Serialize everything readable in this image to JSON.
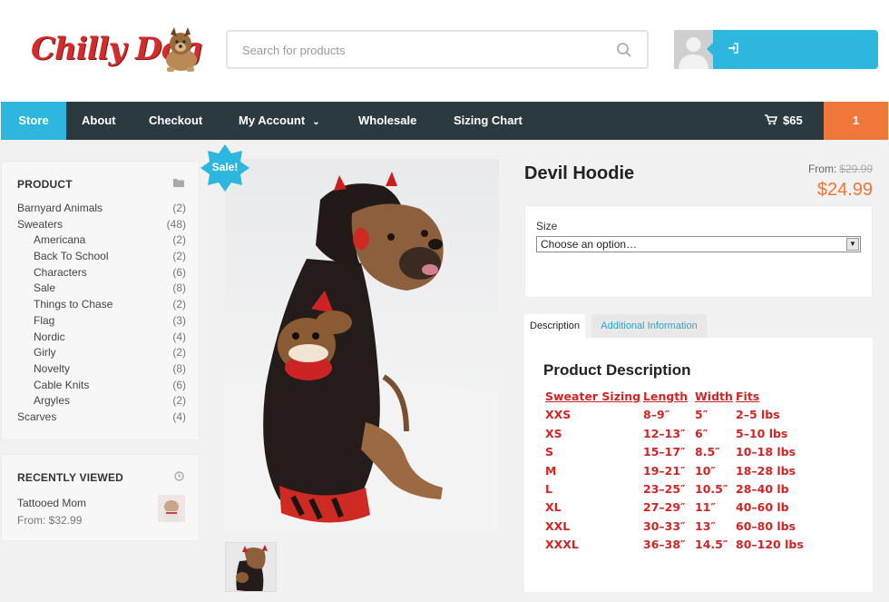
{
  "brand": {
    "name": "Chilly Dog"
  },
  "search": {
    "placeholder": "Search for products"
  },
  "nav": {
    "items": [
      "Store",
      "About",
      "Checkout",
      "My Account",
      "Wholesale",
      "Sizing Chart"
    ],
    "cart_total": "$65",
    "cart_count": "1"
  },
  "sidebar": {
    "product_title": "PRODUCT",
    "categories": [
      {
        "name": "Barnyard Animals",
        "count": "(2)",
        "sub": false
      },
      {
        "name": "Sweaters",
        "count": "(48)",
        "sub": false
      },
      {
        "name": "Americana",
        "count": "(2)",
        "sub": true
      },
      {
        "name": "Back To School",
        "count": "(2)",
        "sub": true
      },
      {
        "name": "Characters",
        "count": "(6)",
        "sub": true
      },
      {
        "name": "Sale",
        "count": "(8)",
        "sub": true
      },
      {
        "name": "Things to Chase",
        "count": "(2)",
        "sub": true
      },
      {
        "name": "Flag",
        "count": "(3)",
        "sub": true
      },
      {
        "name": "Nordic",
        "count": "(4)",
        "sub": true
      },
      {
        "name": "Girly",
        "count": "(2)",
        "sub": true
      },
      {
        "name": "Novelty",
        "count": "(8)",
        "sub": true
      },
      {
        "name": "Cable Knits",
        "count": "(6)",
        "sub": true
      },
      {
        "name": "Argyles",
        "count": "(2)",
        "sub": true
      },
      {
        "name": "Scarves",
        "count": "(4)",
        "sub": false
      }
    ],
    "recent_title": "RECENTLY VIEWED",
    "recent_item": {
      "name": "Tattooed Mom",
      "price": "From: $32.99"
    }
  },
  "product": {
    "badge": "Sale!",
    "title": "Devil Hoodie",
    "from_label": "From:",
    "old_price": "$29.99",
    "price": "$24.99",
    "size_label": "Size",
    "size_selected": "Choose an option…",
    "tabs": [
      "Description",
      "Additional Information"
    ],
    "desc_title": "Product Description",
    "size_table": {
      "header": [
        "Sweater Sizing",
        "Length",
        "Width",
        "Fits"
      ],
      "rows": [
        [
          "XXS",
          "8–9″",
          "5″",
          "2–5 lbs"
        ],
        [
          "XS",
          "12–13″",
          "6″",
          "5–10 lbs"
        ],
        [
          "S",
          "15–17″",
          "8.5″",
          "10–18 lbs"
        ],
        [
          "M",
          "19–21″",
          "10″",
          "18–28 lbs"
        ],
        [
          "L",
          "23–25″",
          "10.5″",
          "28–40 lb"
        ],
        [
          "XL",
          "27–29″",
          "11″",
          "40–60 lb"
        ],
        [
          "XXL",
          "30–33″",
          "13″",
          "60–80 lbs"
        ],
        [
          "XXXL",
          "36–38″",
          "14.5″",
          "80–120 lbs"
        ]
      ]
    }
  },
  "colors": {
    "accent": "#2db6de",
    "nav": "#2b3a3f",
    "orange": "#f0773a",
    "table_red": "#d22424"
  }
}
